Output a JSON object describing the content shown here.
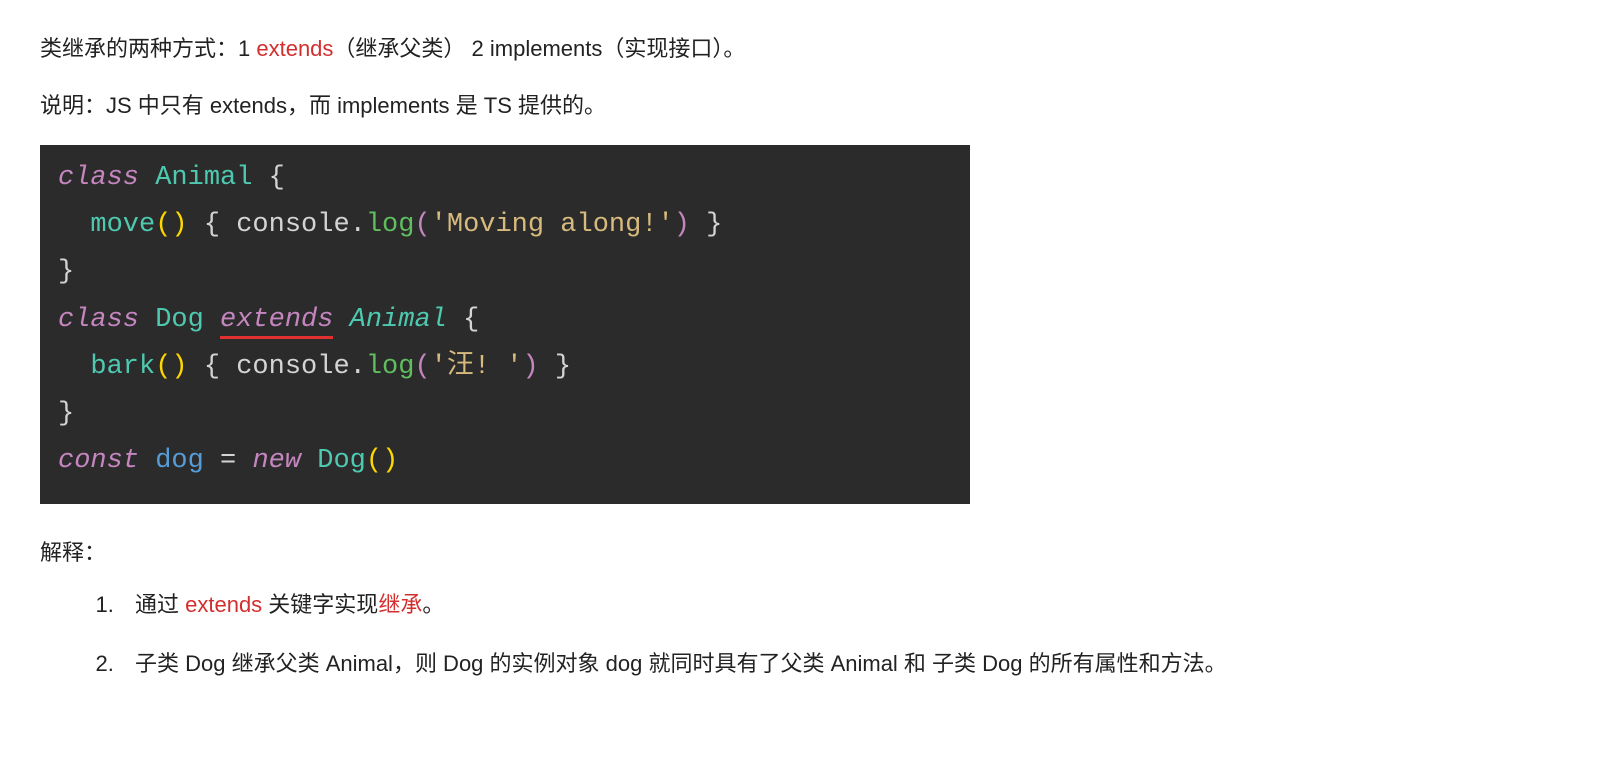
{
  "paragraph1": {
    "pre": "类继承的两种方式：1 ",
    "extends": "extends",
    "mid": "（继承父类） 2 implements（实现接口）。"
  },
  "paragraph2": "说明：JS 中只有 extends，而 implements 是 TS 提供的。",
  "code": {
    "line1": {
      "class_kw": "class",
      "name": "Animal",
      "brace": " {"
    },
    "line2": {
      "indent": "  ",
      "method": "move",
      "p1": "(",
      "p2": ") ",
      "brace1": "{ ",
      "obj": "console",
      "dot": ".",
      "func": "log",
      "p3": "(",
      "str": "'Moving along!'",
      "p4": ")",
      "brace2": " }"
    },
    "line3": {
      "brace": "}"
    },
    "line4": {
      "class_kw": "class",
      "name": "Dog",
      "extends_kw": "extends",
      "parent": "Animal",
      "brace": " {"
    },
    "line5": {
      "indent": "  ",
      "method": "bark",
      "p1": "(",
      "p2": ") ",
      "brace1": "{ ",
      "obj": "console",
      "dot": ".",
      "func": "log",
      "p3": "(",
      "str": "'汪! '",
      "p4": ")",
      "brace2": " }"
    },
    "line6": {
      "brace": "}"
    },
    "line7": {
      "const_kw": "const",
      "var": "dog",
      "eq": " = ",
      "new_kw": "new",
      "cls": "Dog",
      "p1": "(",
      "p2": ")"
    }
  },
  "explain_label": "解释：",
  "list": {
    "item1": {
      "pre": "通过 ",
      "extends": "extends",
      "mid": " 关键字实现",
      "inherit": "继承",
      "post": "。"
    },
    "item2": "子类 Dog 继承父类 Animal，则 Dog 的实例对象 dog 就同时具有了父类 Animal 和 子类 Dog 的所有属性和方法。"
  }
}
